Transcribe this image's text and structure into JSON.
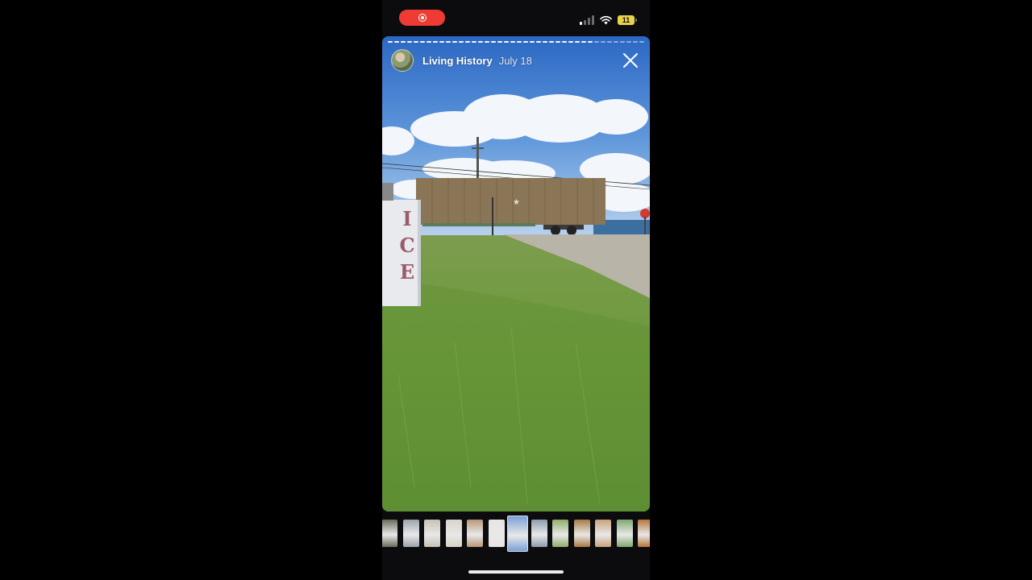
{
  "story": {
    "username": "Living History",
    "date": "July 18",
    "sign_text": "ICE",
    "progress_segments": 40,
    "progress_completed": 32
  },
  "status_bar": {
    "battery_level": "11",
    "recording": true,
    "wifi": true,
    "signal_bars_active": 1
  },
  "icons": {
    "close": "close-icon",
    "record": "screen-record-icon",
    "signal": "signal-icon",
    "wifi": "wifi-icon",
    "battery": "battery-icon"
  },
  "thumbnails": {
    "count": 13,
    "active_index": 6,
    "colors": [
      "#6b6b5a",
      "#9aa4ac",
      "#c8c0b4",
      "#d9d2c8",
      "#b89878",
      "#e8e6e4",
      "#7aa0d8",
      "#8c9cb0",
      "#8fae6a",
      "#a87a44",
      "#c9a27c",
      "#7fa870",
      "#b8743a"
    ]
  },
  "colors": {
    "record_pill": "#ee3b34",
    "battery": "#e9d24a",
    "background": "#000000"
  }
}
